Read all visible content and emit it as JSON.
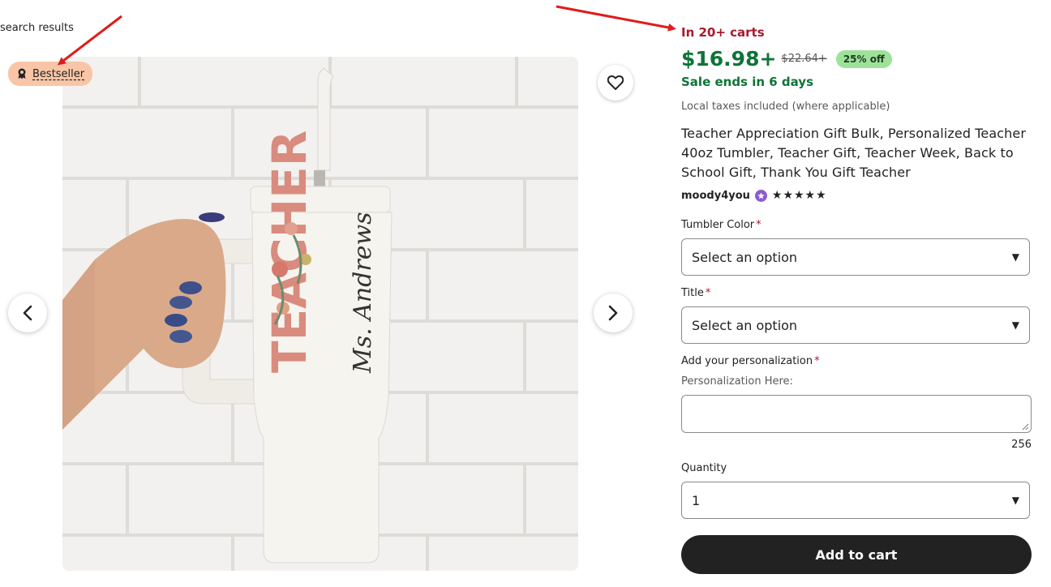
{
  "nav": {
    "back_link": "search results"
  },
  "gallery": {
    "badge": "Bestseller",
    "prev_icon": "chevron-left-icon",
    "next_icon": "chevron-right-icon",
    "favorite_icon": "heart-icon"
  },
  "product": {
    "carts": "In 20+ carts",
    "price": "$16.98+",
    "original_price": "$22.64+",
    "discount": "25% off",
    "sale": "Sale ends in 6 days",
    "taxes": "Local taxes included (where applicable)",
    "title": "Teacher Appreciation Gift Bulk, Personalized Teacher 40oz Tumbler, Teacher Gift, Teacher Week, Back to School Gift, Thank You Gift Teacher",
    "seller": "moody4you",
    "stars": "★★★★★",
    "rating": 5
  },
  "form": {
    "required_mark": "*",
    "tumbler_color": {
      "label": "Tumbler Color",
      "value": "Select an option"
    },
    "title_field": {
      "label": "Title",
      "value": "Select an option"
    },
    "personalization": {
      "label": "Add your personalization",
      "sub_label": "Personalization Here:",
      "value": "",
      "remaining": "256"
    },
    "quantity": {
      "label": "Quantity",
      "value": "1"
    },
    "add_to_cart": "Add to cart"
  },
  "colors": {
    "price_green": "#0e7437",
    "carts_red": "#a61a2e",
    "discount_bg": "#9ee29a",
    "badge_bg": "#f8c6a6",
    "button_dark": "#222222",
    "annotation_arrow": "#e01b1b"
  }
}
